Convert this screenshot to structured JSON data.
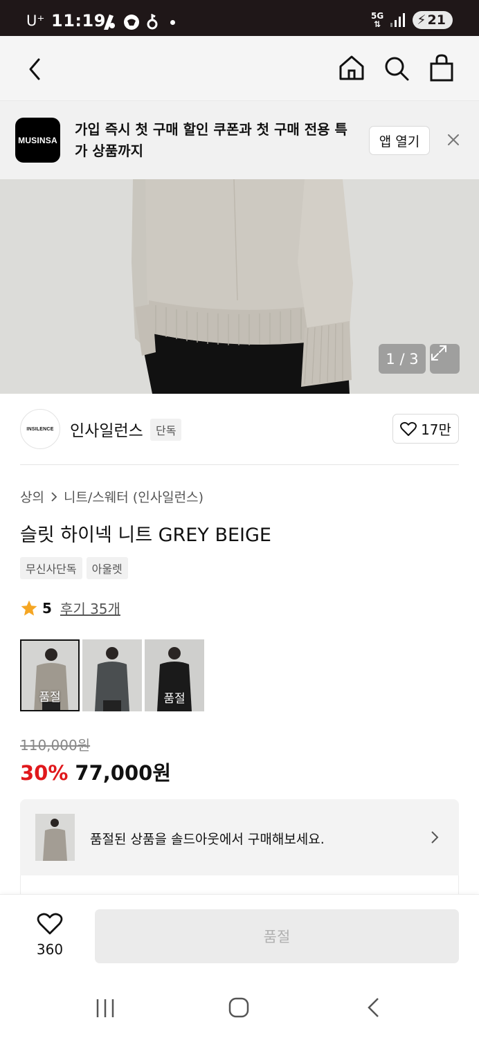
{
  "status_bar": {
    "carrier": "U⁺",
    "time": "11:19",
    "network": "5G",
    "battery": "21"
  },
  "nav": {
    "back_icon": "chevron-left-icon",
    "home_icon": "home-icon",
    "search_icon": "search-icon",
    "bag_icon": "shopping-bag-icon"
  },
  "promo": {
    "logo_text": "MUSINSA",
    "text": "가입 즉시 첫 구매 할인 쿠폰과 첫 구매 전용 특가 상품까지",
    "open_app_label": "앱 열기",
    "close_icon": "close-icon"
  },
  "hero": {
    "counter": "1 / 3",
    "expand_icon": "expand-icon"
  },
  "brand": {
    "logo_text": "INSILENCE",
    "name": "인사일런스",
    "badge": "단독",
    "like_count": "17만"
  },
  "product": {
    "breadcrumb": [
      "상의",
      "니트/스웨터 (인사일런스)"
    ],
    "title": "슬릿 하이넥 니트 GREY BEIGE",
    "tags": [
      "무신사단독",
      "아울렛"
    ],
    "rating": "5",
    "review_link": "후기 35개",
    "variants": [
      {
        "label": "품절",
        "color": "#9b958c",
        "selected": true
      },
      {
        "label": "",
        "color": "#4a4e50",
        "selected": false
      },
      {
        "label": "품절",
        "color": "#1a1a1a",
        "selected": false
      }
    ],
    "original_price": "110,000원",
    "discount": "30%",
    "sale_price": "77,000원"
  },
  "soldout_card": {
    "text": "품절된 상품을 솔드아웃에서 구매해보세요."
  },
  "action_bar": {
    "wish_count": "360",
    "buy_label": "품절"
  },
  "colors": {
    "discount_red": "#e0181c",
    "status_bar_bg": "#1f1718"
  }
}
